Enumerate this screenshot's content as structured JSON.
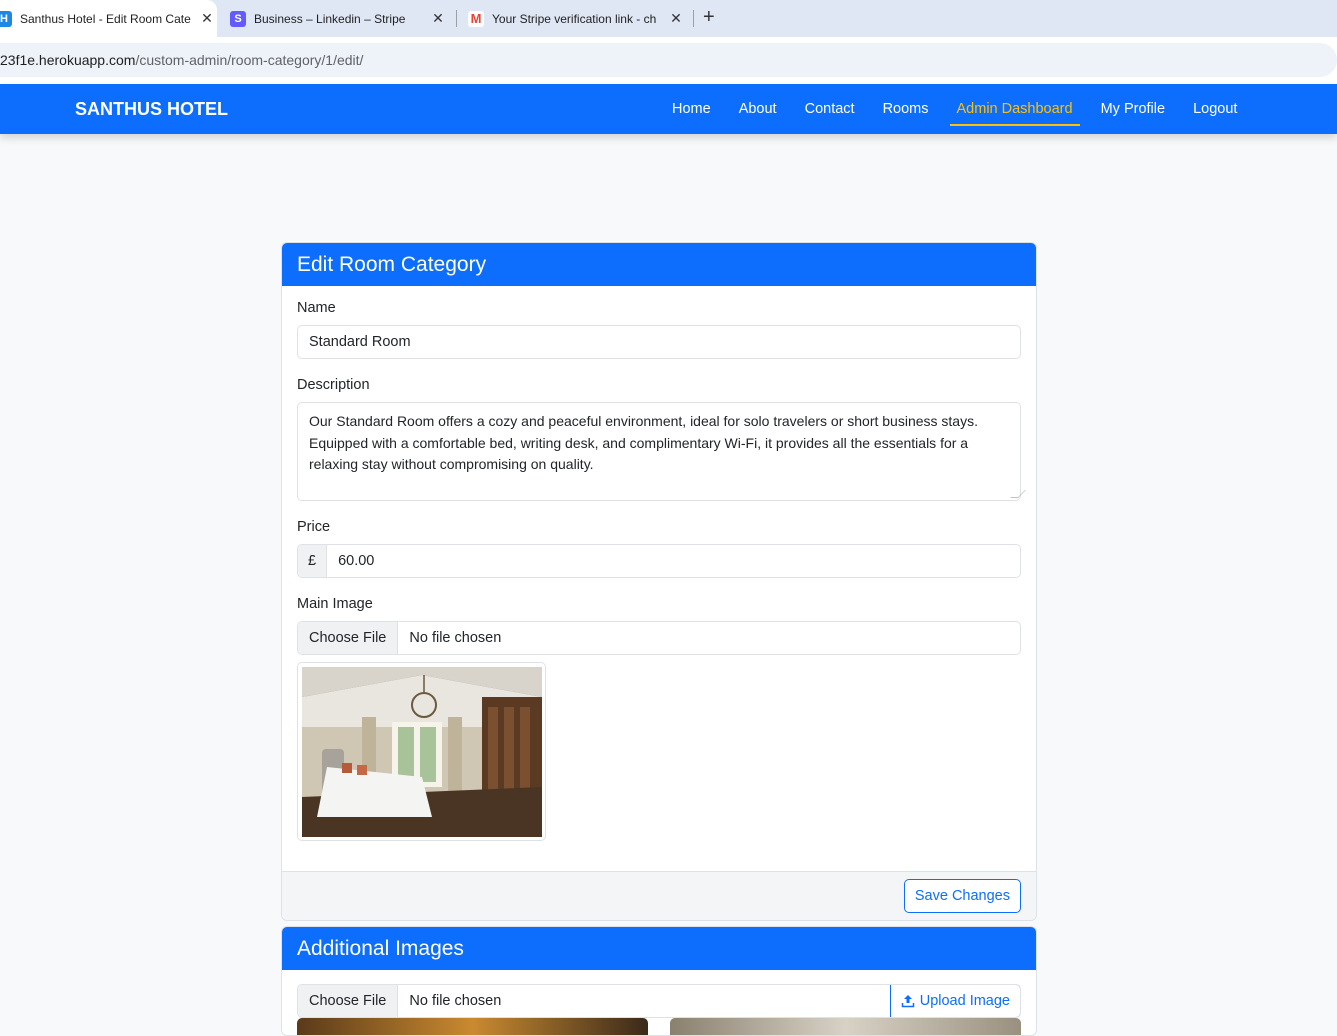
{
  "browser": {
    "tabs": [
      {
        "title": "Santhus Hotel - Edit Room Cate",
        "favicon_letter": "H",
        "favicon_color": "#0d6efd"
      },
      {
        "title": "Business – Linkedin – Stripe",
        "favicon_letter": "S",
        "favicon_color": "#635bff"
      },
      {
        "title": "Your Stripe verification link - ch",
        "favicon_letter": "M",
        "favicon_color": "#ea4335"
      }
    ],
    "close_glyph": "✕",
    "new_tab_glyph": "+",
    "url_host": "23f1e.herokuapp.com",
    "url_path": "/custom-admin/room-category/1/edit/"
  },
  "navbar": {
    "brand": "SANTHUS HOTEL",
    "links": [
      "Home",
      "About",
      "Contact",
      "Rooms",
      "Admin Dashboard",
      "My Profile",
      "Logout"
    ],
    "active_link": "Admin Dashboard",
    "accent_color": "#0d6efd",
    "active_color": "#ffc107"
  },
  "edit_card": {
    "title": "Edit Room Category",
    "name_label": "Name",
    "name_value": "Standard Room",
    "description_label": "Description",
    "description_value": "Our Standard Room offers a cozy and peaceful environment, ideal for solo travelers or short business stays. Equipped with a comfortable bed, writing desk, and complimentary Wi-Fi, it provides all the essentials for a relaxing stay without compromising on quality.",
    "price_label": "Price",
    "currency_symbol": "£",
    "price_value": "60.00",
    "main_image_label": "Main Image",
    "choose_file_label": "Choose File",
    "no_file_label": "No file chosen",
    "save_button": "Save Changes"
  },
  "additional_card": {
    "title": "Additional Images",
    "choose_file_label": "Choose File",
    "no_file_label": "No file chosen",
    "upload_button": "Upload Image",
    "upload_icon": "upload-icon"
  }
}
